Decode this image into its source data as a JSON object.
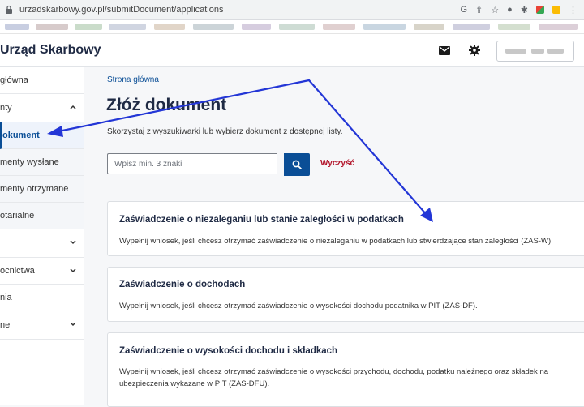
{
  "browser": {
    "url": "urzadskarbowy.gov.pl/submitDocument/applications",
    "icons": [
      "google-icon",
      "share-icon",
      "bookmark-star-icon"
    ]
  },
  "header": {
    "brand": "Urząd Skarbowy",
    "mail_icon": "envelope-icon",
    "settings_icon": "gear-icon"
  },
  "sidebar": {
    "items": [
      {
        "label": "główna"
      },
      {
        "label": "nty"
      },
      {
        "label": "okument"
      },
      {
        "label": "menty wysłane"
      },
      {
        "label": "menty otrzymane"
      },
      {
        "label": "otarialne"
      },
      {
        "label": ""
      },
      {
        "label": "ocnictwa"
      },
      {
        "label": "nia"
      },
      {
        "label": "ne"
      }
    ]
  },
  "main": {
    "breadcrumb": "Strona główna",
    "title": "Złóż dokument",
    "subtitle": "Skorzystaj z wyszukiwarki lub wybierz dokument z dostępnej listy.",
    "search_placeholder": "Wpisz min. 3 znaki",
    "clear_label": "Wyczyść",
    "documents": [
      {
        "title": "Zaświadczenie o niezaleganiu lub stanie zaległości w podatkach",
        "description": "Wypełnij wniosek, jeśli chcesz otrzymać zaświadczenie o niezaleganiu w podatkach lub stwierdzające stan zaległości (ZAS-W)."
      },
      {
        "title": "Zaświadczenie o dochodach",
        "description": "Wypełnij wniosek, jeśli chcesz otrzymać zaświadczenie o wysokości dochodu podatnika w PIT (ZAS-DF)."
      },
      {
        "title": "Zaświadczenie o wysokości dochodu i składkach",
        "description": "Wypełnij wniosek, jeśli chcesz otrzymać zaświadczenie o wysokości przychodu, dochodu, podatku należnego oraz składek na ubezpieczenia wykazane w PIT (ZAS-DFU)."
      }
    ]
  },
  "colors": {
    "primary": "#0a4e96",
    "clear": "#b3162c",
    "annotation_arrow": "#2336d6"
  }
}
